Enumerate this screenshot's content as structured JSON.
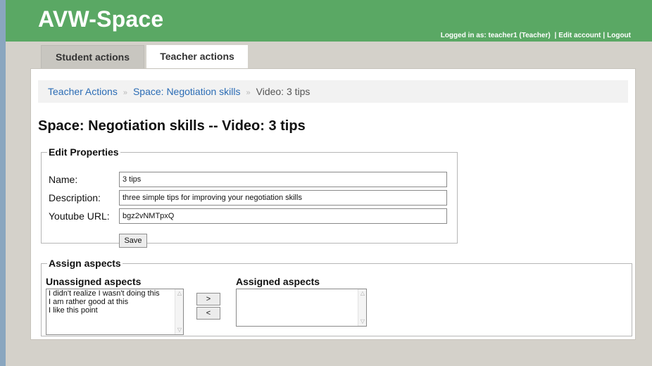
{
  "header": {
    "app_title": "AVW-Space",
    "logged_in_prefix": "Logged in as:",
    "user": "teacher1 (Teacher)",
    "edit_account": "Edit account",
    "logout": "Logout",
    "separator": "|",
    "brand_color": "#5aa864"
  },
  "tabs": [
    {
      "label": "Student actions",
      "active": false
    },
    {
      "label": "Teacher actions",
      "active": true
    }
  ],
  "breadcrumb": {
    "items": [
      "Teacher Actions",
      "Space: Negotiation skills"
    ],
    "current": "Video: 3 tips",
    "separator": "»"
  },
  "page_title": "Space: Negotiation skills -- Video: 3 tips",
  "edit_properties": {
    "legend": "Edit Properties",
    "fields": [
      {
        "label": "Name:",
        "value": "3 tips"
      },
      {
        "label": "Description:",
        "value": "three simple tips for improving your negotiation skills"
      },
      {
        "label": "Youtube URL:",
        "value": "bgz2vNMTpxQ"
      }
    ],
    "save_label": "Save"
  },
  "assign_aspects": {
    "legend": "Assign aspects",
    "unassigned_title": "Unassigned aspects",
    "assigned_title": "Assigned aspects",
    "unassigned_items": [
      "I didn't realize I wasn't doing this",
      "I am rather good at this",
      "I like this point"
    ],
    "assigned_items": [],
    "move_right_label": ">",
    "move_left_label": "<"
  }
}
